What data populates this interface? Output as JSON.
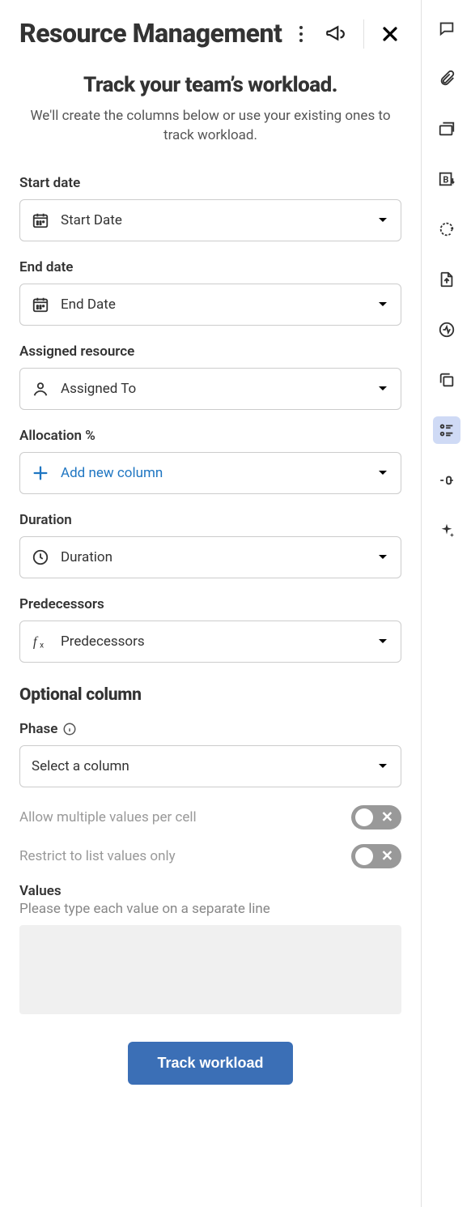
{
  "header": {
    "title": "Resource Management"
  },
  "intro": {
    "title": "Track your team’s workload.",
    "description": "We'll create the columns below or use your existing ones to track workload."
  },
  "fields": {
    "start_date": {
      "label": "Start date",
      "value": "Start Date"
    },
    "end_date": {
      "label": "End date",
      "value": "End Date"
    },
    "assigned": {
      "label": "Assigned resource",
      "value": "Assigned To"
    },
    "allocation": {
      "label": "Allocation %",
      "add_text": "Add new column"
    },
    "duration": {
      "label": "Duration",
      "value": "Duration"
    },
    "predecessors": {
      "label": "Predecessors",
      "value": "Predecessors"
    }
  },
  "optional": {
    "section_title": "Optional column",
    "phase_label": "Phase",
    "phase_placeholder": "Select a column",
    "allow_multiple": "Allow multiple values per cell",
    "restrict_list": "Restrict to list values only",
    "values_label": "Values",
    "values_hint": "Please type each value on a separate line"
  },
  "submit": {
    "label": "Track workload"
  }
}
